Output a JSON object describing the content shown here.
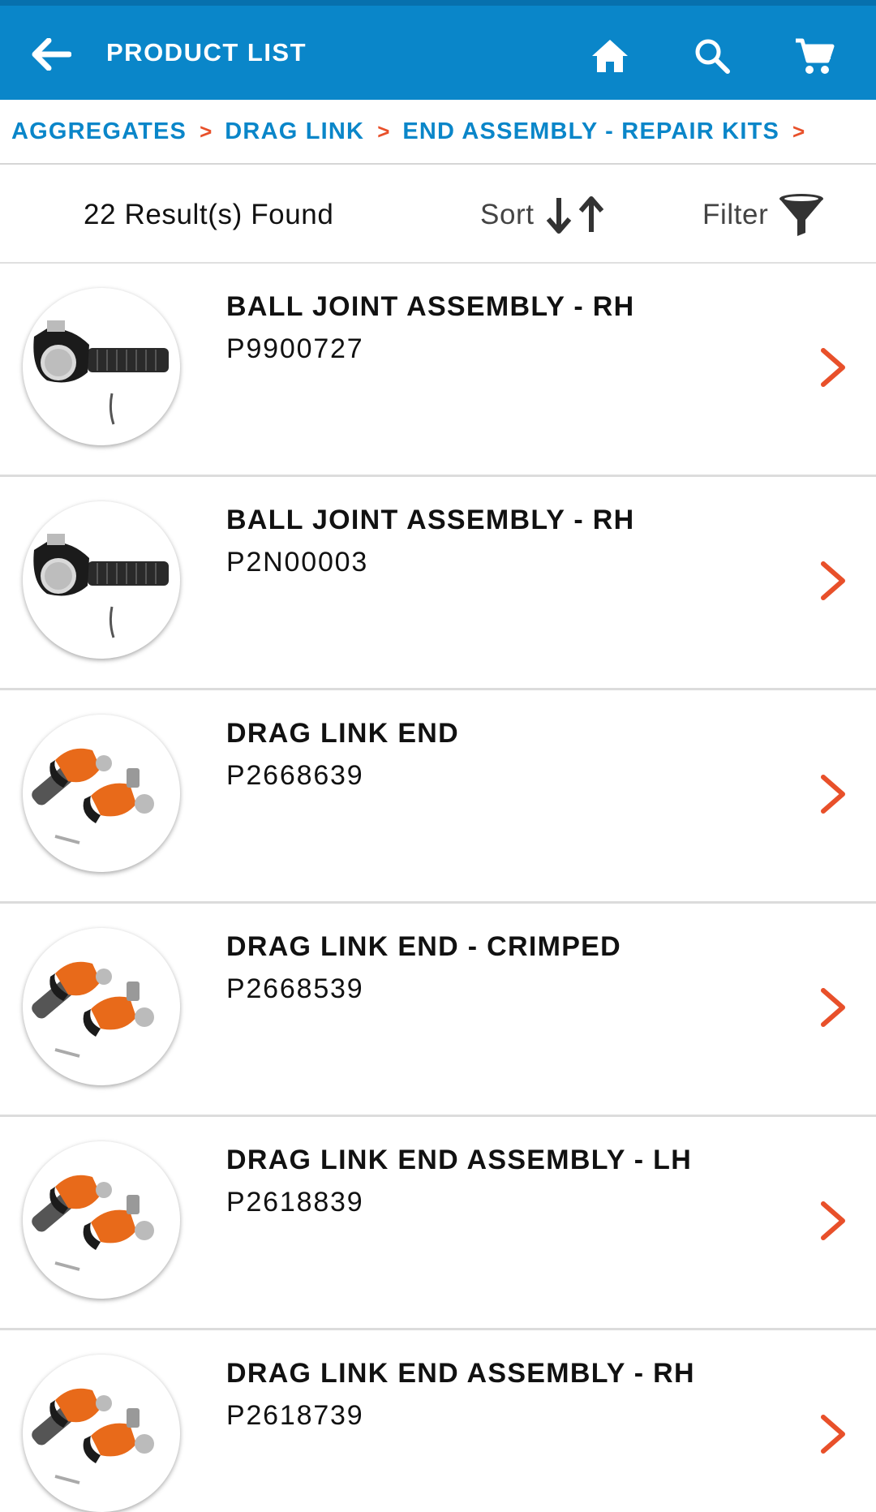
{
  "header": {
    "title": "PRODUCT LIST",
    "back_icon": "arrow-left-icon",
    "home_icon": "home-icon",
    "search_icon": "search-icon",
    "cart_icon": "cart-icon",
    "bg_color": "#0a86c9"
  },
  "breadcrumb": {
    "items": [
      "AGGREGATES",
      "DRAG LINK",
      "END ASSEMBLY - REPAIR KITS"
    ],
    "separator": ">"
  },
  "toolbar": {
    "results_label": "22 Result(s) Found",
    "sort_label": "Sort",
    "filter_label": "Filter"
  },
  "products": [
    {
      "name": "BALL JOINT ASSEMBLY - RH",
      "code": "P9900727",
      "image": "ball-joint"
    },
    {
      "name": "BALL JOINT ASSEMBLY - RH",
      "code": "P2N00003",
      "image": "ball-joint"
    },
    {
      "name": "DRAG LINK END",
      "code": "P2668639",
      "image": "drag-link-end"
    },
    {
      "name": "DRAG LINK END - CRIMPED",
      "code": "P2668539",
      "image": "drag-link-end"
    },
    {
      "name": "DRAG LINK END ASSEMBLY - LH",
      "code": "P2618839",
      "image": "drag-link-end"
    },
    {
      "name": "DRAG LINK END ASSEMBLY - RH",
      "code": "P2618739",
      "image": "drag-link-end"
    }
  ],
  "colors": {
    "accent": "#0a86c9",
    "chevron": "#e8502a"
  }
}
